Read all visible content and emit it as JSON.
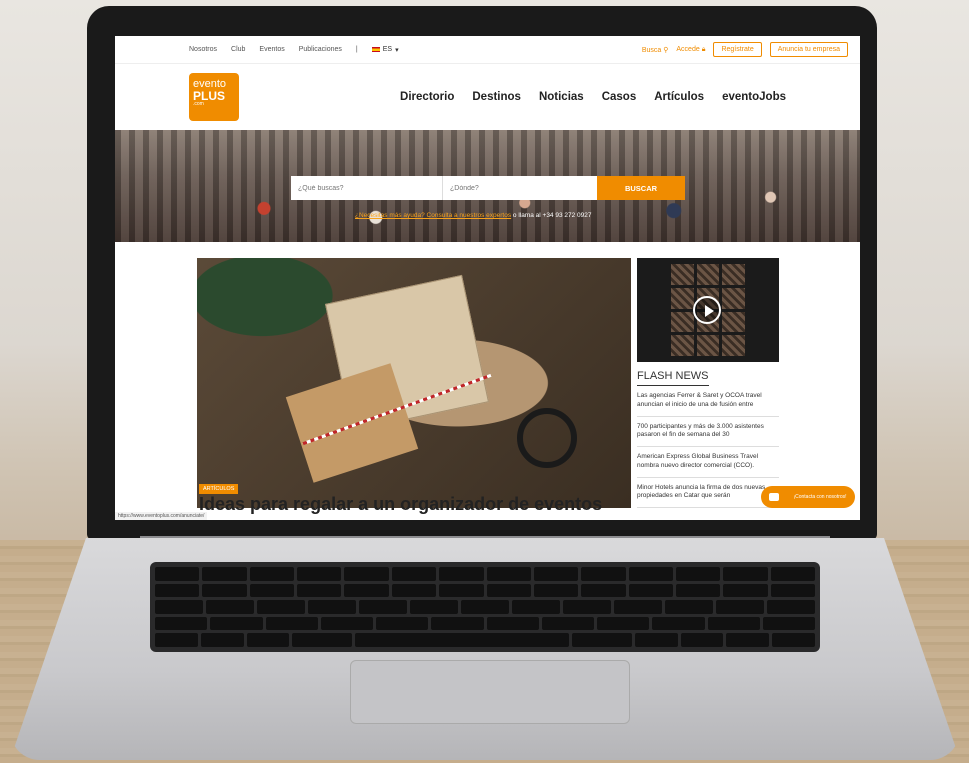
{
  "topbar": {
    "links": [
      "Nosotros",
      "Club",
      "Eventos",
      "Publicaciones"
    ],
    "lang": "ES",
    "busca": "Busca",
    "accede": "Accede",
    "register": "Regístrate",
    "advertise": "Anuncia tu empresa"
  },
  "logo": {
    "line1": "evento",
    "line2": "PLUS",
    "line3": ".com"
  },
  "nav": [
    "Directorio",
    "Destinos",
    "Noticias",
    "Casos",
    "Artículos",
    "eventoJobs"
  ],
  "search": {
    "what_placeholder": "¿Qué buscas?",
    "where_placeholder": "¿Dónde?",
    "button": "BUSCAR",
    "help_link": "¿Necesitas más ayuda? Consulta a nuestros expertos",
    "help_tail": " o llama al +34 93 272 0927"
  },
  "article": {
    "tag": "ARTÍCULOS",
    "title": "Ideas para regalar a un organizador de eventos"
  },
  "sidebar": {
    "flash_title": "FLASH NEWS",
    "news": [
      "Las agencias Ferrer & Saret y OCOA travel anuncian el inicio de una de fusión entre",
      "700 participantes y más de 3.000 asistentes pasaron el fin de semana del 30",
      "American Express Global Business Travel nombra nuevo director comercial (CCO).",
      "Minor Hotels anuncia la firma de dos nuevas propiedades en Catar que serán"
    ]
  },
  "contact": "¡Contacta con nosotros!",
  "status_url": "https://www.eventoplus.com/anunciate/",
  "colors": {
    "brand": "#f08c00"
  }
}
